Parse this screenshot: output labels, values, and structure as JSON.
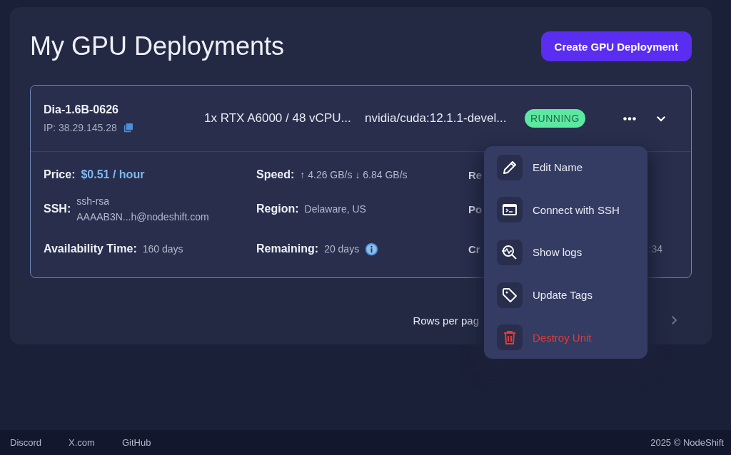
{
  "page": {
    "title": "My GPU Deployments",
    "create_button": "Create GPU Deployment"
  },
  "deployments": [
    {
      "name": "Dia-1.6B-0626",
      "ip": "IP: 38.29.145.28",
      "gpu": "1x RTX A6000 / 48 vCPU...",
      "image": "nvidia/cuda:12.1.1-devel...",
      "status": {
        "label": "RUNNING",
        "kind": "running"
      },
      "expanded": true,
      "details": [
        {
          "kind": "price",
          "label": "Price:",
          "value": "$0.51 / hour"
        },
        {
          "kind": "text",
          "label": "Speed:",
          "value": "↑ 4.26 GB/s ↓ 6.84 GB/s"
        },
        {
          "kind": "text",
          "label": "Re"
        },
        {
          "kind": "multiline",
          "label": "SSH:",
          "lines": [
            "ssh-rsa",
            "AAAAB3N...h@nodeshift.com"
          ]
        },
        {
          "kind": "text",
          "label": "Region:",
          "value": "Delaware, US"
        },
        {
          "kind": "text",
          "label": "Po"
        },
        {
          "kind": "text",
          "label": "Availability Time:",
          "value": "160 days"
        },
        {
          "kind": "info",
          "label": "Remaining:",
          "value": "20 days"
        },
        {
          "kind": "split",
          "label": "Cr",
          "value": ":34"
        }
      ]
    }
  ],
  "menu": [
    {
      "kind": "normal",
      "label": "Edit Name"
    },
    {
      "kind": "normal",
      "label": "Connect with SSH"
    },
    {
      "kind": "normal",
      "label": "Show logs"
    },
    {
      "kind": "normal",
      "label": "Update Tags"
    },
    {
      "kind": "danger",
      "label": "Destroy Unit"
    }
  ],
  "pagination": {
    "label": "Rows per pag"
  },
  "footer": {
    "links": [
      "Discord",
      "X.com",
      "GitHub"
    ],
    "copyright": "2025 © NodeShift"
  }
}
